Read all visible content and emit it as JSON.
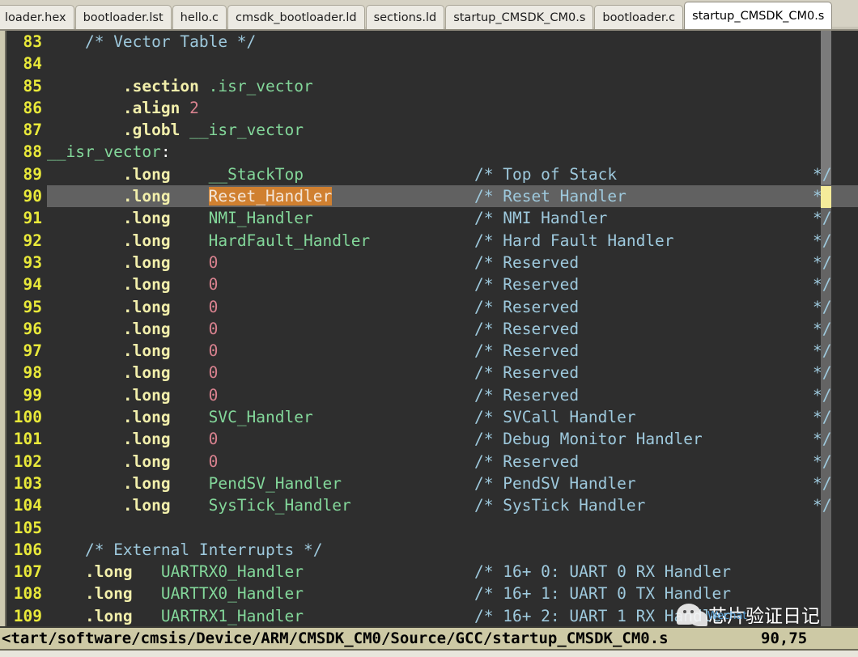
{
  "tabs": [
    {
      "label": "loader.hex",
      "active": false
    },
    {
      "label": "bootloader.lst",
      "active": false
    },
    {
      "label": "hello.c",
      "active": false
    },
    {
      "label": "cmsdk_bootloader.ld",
      "active": false
    },
    {
      "label": "sections.ld",
      "active": false
    },
    {
      "label": "startup_CMSDK_CM0.s",
      "active": false
    },
    {
      "label": "bootloader.c",
      "active": false
    },
    {
      "label": "startup_CMSDK_CM0.s",
      "active": true
    }
  ],
  "editor": {
    "colors": {
      "background": "#2e2e2e",
      "current_line": "#616161",
      "line_number": "#e9e93a",
      "directive": "#f2efab",
      "symbol": "#83d79a",
      "number": "#d9828f",
      "comment": "#9ec9dd",
      "search_match_bg": "#d08030",
      "caret": "#f5ec9a",
      "scrollbar": "#7b7b7b",
      "status_bar": "#cdc9a5",
      "tab_bar": "#d6d2c4"
    },
    "current_line_number": 90,
    "lines": [
      {
        "no": 83,
        "tokens": [
          {
            "t": "    ",
            "c": ""
          },
          {
            "t": "/* Vector Table */",
            "c": "t-cmt"
          }
        ]
      },
      {
        "no": 84,
        "tokens": []
      },
      {
        "no": 85,
        "tokens": [
          {
            "t": "        ",
            "c": ""
          },
          {
            "t": ".section",
            "c": "t-dir"
          },
          {
            "t": " ",
            "c": ""
          },
          {
            "t": ".isr_vector",
            "c": "t-sym"
          }
        ]
      },
      {
        "no": 86,
        "tokens": [
          {
            "t": "        ",
            "c": ""
          },
          {
            "t": ".align",
            "c": "t-dir"
          },
          {
            "t": " ",
            "c": ""
          },
          {
            "t": "2",
            "c": "t-num"
          }
        ]
      },
      {
        "no": 87,
        "tokens": [
          {
            "t": "        ",
            "c": ""
          },
          {
            "t": ".globl",
            "c": "t-dir"
          },
          {
            "t": " ",
            "c": ""
          },
          {
            "t": "__isr_vector",
            "c": "t-sym"
          }
        ]
      },
      {
        "no": 88,
        "tokens": [
          {
            "t": "__isr_vector",
            "c": "t-sym"
          },
          {
            "t": ":",
            "c": "t-punct"
          }
        ]
      },
      {
        "no": 89,
        "tokens": [
          {
            "t": "        ",
            "c": ""
          },
          {
            "t": ".long",
            "c": "t-dir"
          },
          {
            "t": "    ",
            "c": ""
          },
          {
            "t": "__StackTop",
            "c": "t-sym"
          }
        ],
        "comment": "/* Top of Stack",
        "end": "*/"
      },
      {
        "no": 90,
        "tokens": [
          {
            "t": "        ",
            "c": ""
          },
          {
            "t": ".long",
            "c": "t-dir"
          },
          {
            "t": "    ",
            "c": ""
          },
          {
            "t": "Reset_Handler",
            "c": "t-match"
          }
        ],
        "comment": "/* Reset Handler",
        "end": "*/",
        "current": true
      },
      {
        "no": 91,
        "tokens": [
          {
            "t": "        ",
            "c": ""
          },
          {
            "t": ".long",
            "c": "t-dir"
          },
          {
            "t": "    ",
            "c": ""
          },
          {
            "t": "NMI_Handler",
            "c": "t-sym"
          }
        ],
        "comment": "/* NMI Handler",
        "end": "*/"
      },
      {
        "no": 92,
        "tokens": [
          {
            "t": "        ",
            "c": ""
          },
          {
            "t": ".long",
            "c": "t-dir"
          },
          {
            "t": "    ",
            "c": ""
          },
          {
            "t": "HardFault_Handler",
            "c": "t-sym"
          }
        ],
        "comment": "/* Hard Fault Handler",
        "end": "*/"
      },
      {
        "no": 93,
        "tokens": [
          {
            "t": "        ",
            "c": ""
          },
          {
            "t": ".long",
            "c": "t-dir"
          },
          {
            "t": "    ",
            "c": ""
          },
          {
            "t": "0",
            "c": "t-num"
          }
        ],
        "comment": "/* Reserved",
        "end": "*/"
      },
      {
        "no": 94,
        "tokens": [
          {
            "t": "        ",
            "c": ""
          },
          {
            "t": ".long",
            "c": "t-dir"
          },
          {
            "t": "    ",
            "c": ""
          },
          {
            "t": "0",
            "c": "t-num"
          }
        ],
        "comment": "/* Reserved",
        "end": "*/"
      },
      {
        "no": 95,
        "tokens": [
          {
            "t": "        ",
            "c": ""
          },
          {
            "t": ".long",
            "c": "t-dir"
          },
          {
            "t": "    ",
            "c": ""
          },
          {
            "t": "0",
            "c": "t-num"
          }
        ],
        "comment": "/* Reserved",
        "end": "*/"
      },
      {
        "no": 96,
        "tokens": [
          {
            "t": "        ",
            "c": ""
          },
          {
            "t": ".long",
            "c": "t-dir"
          },
          {
            "t": "    ",
            "c": ""
          },
          {
            "t": "0",
            "c": "t-num"
          }
        ],
        "comment": "/* Reserved",
        "end": "*/"
      },
      {
        "no": 97,
        "tokens": [
          {
            "t": "        ",
            "c": ""
          },
          {
            "t": ".long",
            "c": "t-dir"
          },
          {
            "t": "    ",
            "c": ""
          },
          {
            "t": "0",
            "c": "t-num"
          }
        ],
        "comment": "/* Reserved",
        "end": "*/"
      },
      {
        "no": 98,
        "tokens": [
          {
            "t": "        ",
            "c": ""
          },
          {
            "t": ".long",
            "c": "t-dir"
          },
          {
            "t": "    ",
            "c": ""
          },
          {
            "t": "0",
            "c": "t-num"
          }
        ],
        "comment": "/* Reserved",
        "end": "*/"
      },
      {
        "no": 99,
        "tokens": [
          {
            "t": "        ",
            "c": ""
          },
          {
            "t": ".long",
            "c": "t-dir"
          },
          {
            "t": "    ",
            "c": ""
          },
          {
            "t": "0",
            "c": "t-num"
          }
        ],
        "comment": "/* Reserved",
        "end": "*/"
      },
      {
        "no": 100,
        "tokens": [
          {
            "t": "        ",
            "c": ""
          },
          {
            "t": ".long",
            "c": "t-dir"
          },
          {
            "t": "    ",
            "c": ""
          },
          {
            "t": "SVC_Handler",
            "c": "t-sym"
          }
        ],
        "comment": "/* SVCall Handler",
        "end": "*/"
      },
      {
        "no": 101,
        "tokens": [
          {
            "t": "        ",
            "c": ""
          },
          {
            "t": ".long",
            "c": "t-dir"
          },
          {
            "t": "    ",
            "c": ""
          },
          {
            "t": "0",
            "c": "t-num"
          }
        ],
        "comment": "/* Debug Monitor Handler",
        "end": "*/"
      },
      {
        "no": 102,
        "tokens": [
          {
            "t": "        ",
            "c": ""
          },
          {
            "t": ".long",
            "c": "t-dir"
          },
          {
            "t": "    ",
            "c": ""
          },
          {
            "t": "0",
            "c": "t-num"
          }
        ],
        "comment": "/* Reserved",
        "end": "*/"
      },
      {
        "no": 103,
        "tokens": [
          {
            "t": "        ",
            "c": ""
          },
          {
            "t": ".long",
            "c": "t-dir"
          },
          {
            "t": "    ",
            "c": ""
          },
          {
            "t": "PendSV_Handler",
            "c": "t-sym"
          }
        ],
        "comment": "/* PendSV Handler",
        "end": "*/"
      },
      {
        "no": 104,
        "tokens": [
          {
            "t": "        ",
            "c": ""
          },
          {
            "t": ".long",
            "c": "t-dir"
          },
          {
            "t": "    ",
            "c": ""
          },
          {
            "t": "SysTick_Handler",
            "c": "t-sym"
          }
        ],
        "comment": "/* SysTick Handler",
        "end": "*/"
      },
      {
        "no": 105,
        "tokens": []
      },
      {
        "no": 106,
        "tokens": [
          {
            "t": "    ",
            "c": ""
          },
          {
            "t": "/* External Interrupts */",
            "c": "t-cmt"
          }
        ]
      },
      {
        "no": 107,
        "tokens": [
          {
            "t": "    ",
            "c": ""
          },
          {
            "t": ".long",
            "c": "t-dir"
          },
          {
            "t": "   ",
            "c": ""
          },
          {
            "t": "UARTRX0_Handler",
            "c": "t-sym"
          }
        ],
        "comment": "/* 16+ 0: UART 0 RX Handler"
      },
      {
        "no": 108,
        "tokens": [
          {
            "t": "    ",
            "c": ""
          },
          {
            "t": ".long",
            "c": "t-dir"
          },
          {
            "t": "   ",
            "c": ""
          },
          {
            "t": "UARTTX0_Handler",
            "c": "t-sym"
          }
        ],
        "comment": "/* 16+ 1: UART 0 TX Handler"
      },
      {
        "no": 109,
        "tokens": [
          {
            "t": "    ",
            "c": ""
          },
          {
            "t": ".long",
            "c": "t-dir"
          },
          {
            "t": "   ",
            "c": ""
          },
          {
            "t": "UARTRX1_Handler",
            "c": "t-sym"
          }
        ],
        "comment": "/* 16+ 2: UART 1 RX Handler"
      }
    ]
  },
  "status": {
    "path": "<tart/software/cmsis/Device/ARM/CMSDK_CM0/Source/GCC/startup_CMSDK_CM0.s",
    "position": "90,75"
  },
  "watermark": {
    "text": "芯片验证日记",
    "sub": "Wechat",
    "icon": "wechat-icon"
  }
}
